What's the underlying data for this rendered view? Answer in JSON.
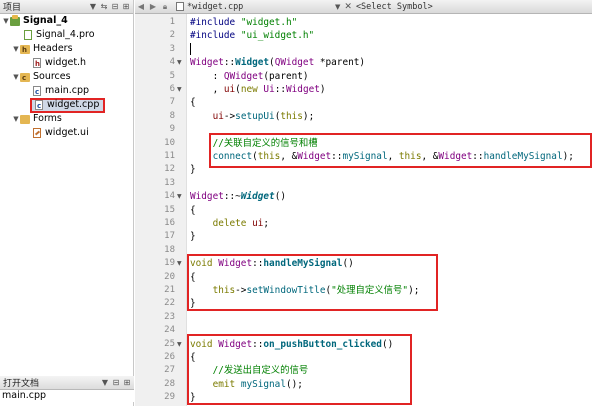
{
  "left_panel": {
    "title": "项目",
    "tree": {
      "project": "Signal_4",
      "project_file": "Signal_4.pro",
      "headers_label": "Headers",
      "headers": [
        "widget.h"
      ],
      "sources_label": "Sources",
      "sources": [
        "main.cpp",
        "widget.cpp"
      ],
      "forms_label": "Forms",
      "forms": [
        "widget.ui"
      ]
    },
    "selected_file": "widget.cpp"
  },
  "open_documents": {
    "title": "打开文档",
    "items": [
      "main.cpp"
    ]
  },
  "editor": {
    "file_tab": "widget.cpp",
    "symbol_selector": "<Select Symbol>",
    "line_numbers": [
      "1",
      "2",
      "3",
      "4",
      "5",
      "6",
      "7",
      "8",
      "9",
      "10",
      "11",
      "12",
      "13",
      "14",
      "15",
      "16",
      "17",
      "18",
      "19",
      "20",
      "21",
      "22",
      "23",
      "24",
      "25",
      "26",
      "27",
      "28",
      "29"
    ],
    "code": {
      "l1_pp": "#include",
      "l1_str": "\"widget.h\"",
      "l2_pp": "#include",
      "l2_str": "\"ui_widget.h\"",
      "l4_cls": "Widget",
      "l4_sep": "::",
      "l4_fn": "Widget",
      "l4_open": "(",
      "l4_param_cls": "QWidget",
      "l4_param": " *parent)",
      "l5_a": "    : ",
      "l5_cls": "QWidget",
      "l5_b": "(parent)",
      "l6_a": "    , ",
      "l6_mem": "ui",
      "l6_b": "(",
      "l6_kw": "new",
      "l6_c": " ",
      "l6_ns": "Ui",
      "l6_d": "::",
      "l6_cls": "Widget",
      "l6_e": ")",
      "l7": "{",
      "l8_mem": "ui",
      "l8_a": "->",
      "l8_fn": "setupUi",
      "l8_b": "(",
      "l8_kw": "this",
      "l8_c": ");",
      "l10_cmt": "//关联自定义的信号和槽",
      "l11_fn": "connect",
      "l11_a": "(",
      "l11_kw1": "this",
      "l11_b": ", &",
      "l11_cls1": "Widget",
      "l11_c": "::",
      "l11_fn1": "mySignal",
      "l11_d": ", ",
      "l11_kw2": "this",
      "l11_e": ", &",
      "l11_cls2": "Widget",
      "l11_f": "::",
      "l11_fn2": "handleMySignal",
      "l11_g": ");",
      "l12": "}",
      "l14_cls": "Widget",
      "l14_sep": "::~",
      "l14_fn": "Widget",
      "l14_end": "()",
      "l15": "{",
      "l16_kw": "delete",
      "l16_a": " ",
      "l16_mem": "ui",
      "l16_b": ";",
      "l17": "}",
      "l19_kw": "void",
      "l19_a": " ",
      "l19_cls": "Widget",
      "l19_sep": "::",
      "l19_fn": "handleMySignal",
      "l19_end": "()",
      "l20": "{",
      "l21_kw": "this",
      "l21_a": "->",
      "l21_fn": "setWindowTitle",
      "l21_b": "(",
      "l21_str": "\"处理自定义信号\"",
      "l21_c": ");",
      "l22": "}",
      "l25_kw": "void",
      "l25_a": " ",
      "l25_cls": "Widget",
      "l25_sep": "::",
      "l25_fn": "on_pushButton_clicked",
      "l25_end": "()",
      "l26": "{",
      "l27_cmt": "//发送出自定义的信号",
      "l28_kw": "emit",
      "l28_a": " ",
      "l28_fn": "mySignal",
      "l28_b": "();",
      "l29": "}"
    }
  },
  "colors": {
    "highlight_box": "#e12424",
    "keyword": "#7b7b00",
    "string": "#008000",
    "class": "#800080",
    "function": "#00677c",
    "comment": "#008000"
  }
}
